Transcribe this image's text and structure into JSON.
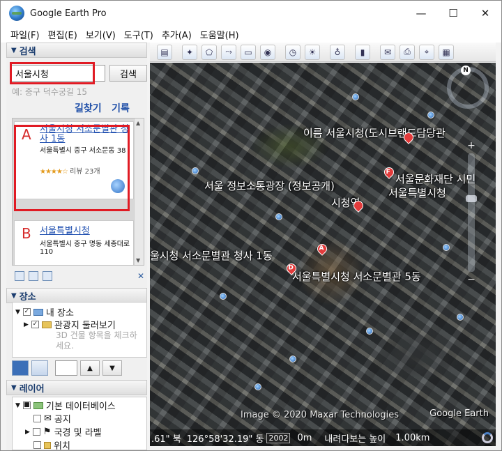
{
  "window": {
    "title": "Google Earth Pro",
    "minimize_glyph": "—",
    "maximize_glyph": "☐",
    "close_glyph": "✕"
  },
  "menu": [
    "파일(F)",
    "편집(E)",
    "보기(V)",
    "도구(T)",
    "추가(A)",
    "도움말(H)"
  ],
  "search": {
    "header": "검색",
    "value": "서울시청",
    "button": "검색",
    "hint": "예: 중구 덕수궁길 15",
    "link_directions": "길찾기",
    "link_history": "기록"
  },
  "results": [
    {
      "letter": "A",
      "title": "서울시청 서소문별관 청사 1동",
      "address": "서울특별시 중구 서소문동 38",
      "stars": "★★★★☆",
      "reviews": "리뷰 23개"
    },
    {
      "letter": "B",
      "title": "서울특별시청",
      "address": "서울특별시 중구 명동 세종대로 110"
    }
  ],
  "places": {
    "header": "장소",
    "my_places": "내 장소",
    "tour": "관광지 둘러보기",
    "tour_hint": "3D 건물 항목을 체크하세요."
  },
  "layers": {
    "header": "레이어",
    "items": [
      "기본 데이터베이스",
      "공지",
      "국경 및 라벨",
      "위치"
    ]
  },
  "map": {
    "labels": [
      "이름 서울시청(도시브랜드담당관",
      "서울문화재단 시민",
      "서울 정보소통광장 (정보공개)",
      "서울특별시청",
      "시청역",
      "울시청 서소문별관 청사 1동",
      "서울특별시청 서소문별관 5동"
    ],
    "pins": [
      "A",
      "D",
      "F"
    ],
    "north": "N",
    "zoom_plus": "+",
    "zoom_minus": "−",
    "credit": "Image © 2020 Maxar Technologies",
    "brand": "Google Earth"
  },
  "status": {
    "lat": ".61\" 북",
    "lon": "126°58'32.19\" 동",
    "year": "2002",
    "scale_start": "0m",
    "prompt": "내려다보는 높이",
    "scale_end": "1.00km"
  }
}
